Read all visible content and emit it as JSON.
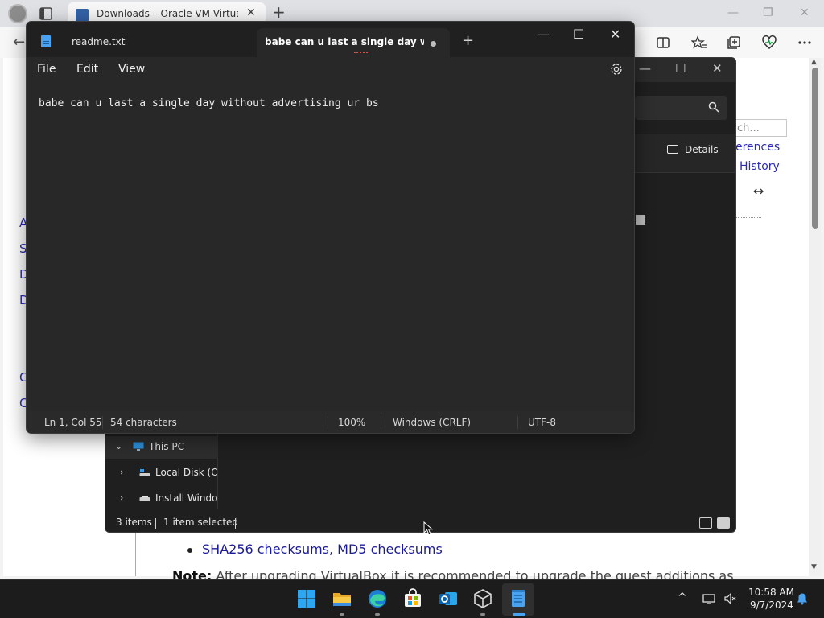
{
  "browser": {
    "tab_title": "Downloads – Oracle VM VirtualBox",
    "tab_close": "✕",
    "new_tab": "+",
    "page": {
      "left_link_letters": [
        "A",
        "S",
        "D",
        "D",
        "C",
        "C"
      ],
      "search_placeholder": "ch...",
      "links": [
        "erences",
        "History"
      ],
      "arrow_glyph": "↔",
      "checksums_text": "SHA256 checksums, MD5 checksums",
      "note_label": "Note:",
      "note_text": " After upgrading VirtualBox it is recommended to upgrade the guest additions as"
    }
  },
  "explorer": {
    "details_label": "Details",
    "nav_items": [
      {
        "label": "This PC",
        "expanded": true
      },
      {
        "label": "Local Disk (C:)",
        "expanded": false
      },
      {
        "label": "Install Windows",
        "expanded": false
      }
    ],
    "status": {
      "items": "3 items",
      "selected": "1 item selected"
    }
  },
  "notepad": {
    "tabs": [
      {
        "label": "readme.txt",
        "active": false
      },
      {
        "label": "babe can u last a single day without advertising ur bs",
        "active": true,
        "unsaved": true
      }
    ],
    "new_tab": "+",
    "menu": [
      "File",
      "Edit",
      "View"
    ],
    "content": "babe can u last a single day without advertising ur bs",
    "status": {
      "position": "Ln 1, Col 55",
      "characters": "54 characters",
      "zoom": "100%",
      "line_ending": "Windows (CRLF)",
      "encoding": "UTF-8"
    },
    "controls": {
      "minimize": "—",
      "maximize": "☐",
      "close": "✕"
    }
  },
  "taskbar": {
    "apps": [
      "start-icon",
      "file-explorer-icon",
      "edge-icon",
      "store-icon",
      "outlook-icon",
      "virtualbox-icon",
      "notepad-icon"
    ],
    "tray_chevron": "^",
    "time": "10:58 AM",
    "date": "9/7/2024"
  },
  "colors": {
    "notepad_bg": "#282828",
    "explorer_bg": "#1f1f1f",
    "link_blue": "#2b2bb5",
    "accent_blue": "#0a84ff"
  }
}
